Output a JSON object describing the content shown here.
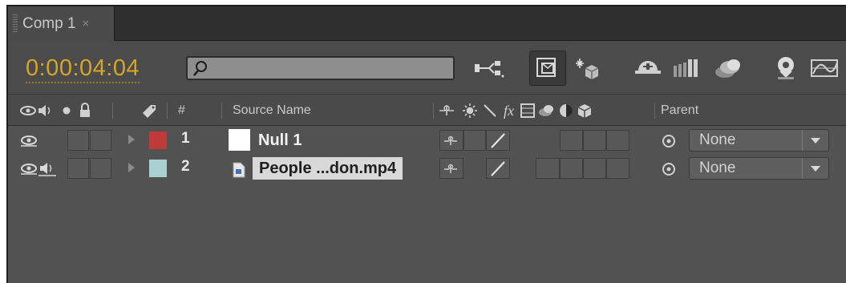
{
  "tab": {
    "title": "Comp 1",
    "close": "×"
  },
  "toolbar": {
    "timecode": "0:00:04:04",
    "search_placeholder": "",
    "icons": [
      "composition-mini-flowchart-icon",
      "draft-3d-icon",
      "hide-shy-layers-icon",
      "frame-blending-icon",
      "motion-blur-icon",
      "brainstorm-icon",
      "graph-editor-icon"
    ]
  },
  "header": {
    "hash": "#",
    "source_name": "Source Name",
    "parent": "Parent"
  },
  "layers": [
    {
      "number": "1",
      "name": "Null 1",
      "label_color": "#c03a3a",
      "parent": "None",
      "video": true,
      "audio": false
    },
    {
      "number": "2",
      "name": "People ...don.mp4",
      "label_color": "#a9d1d0",
      "parent": "None",
      "video": true,
      "audio": true
    }
  ],
  "colors": {
    "timecode": "#d6a525",
    "panel": "#525252"
  }
}
